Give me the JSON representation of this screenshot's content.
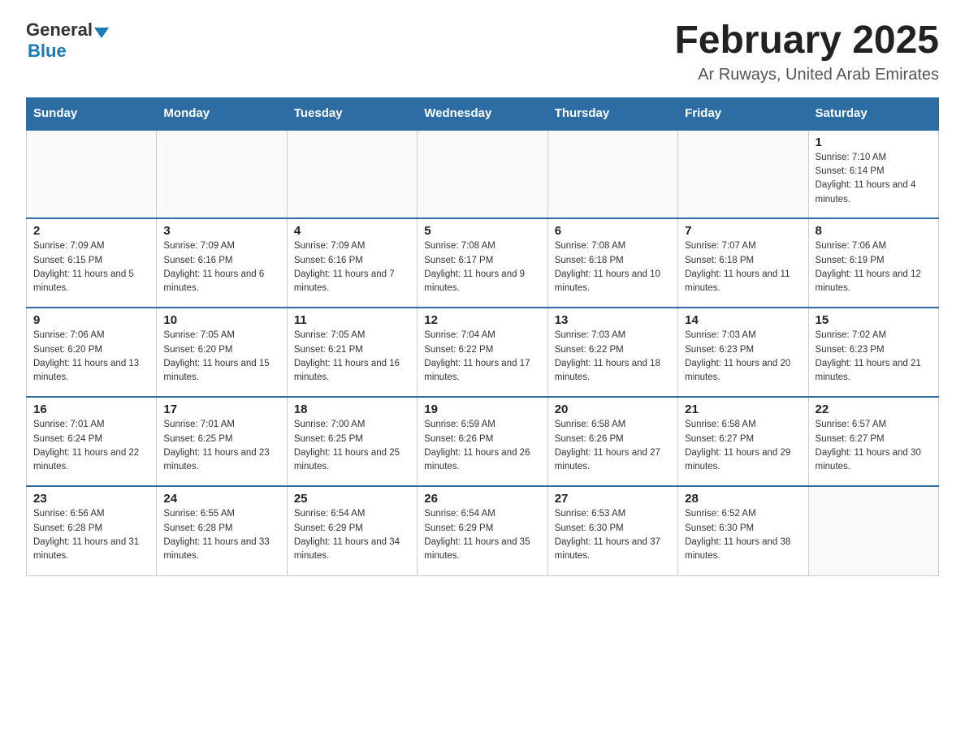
{
  "header": {
    "logo_general": "General",
    "logo_blue": "Blue",
    "month_title": "February 2025",
    "location": "Ar Ruways, United Arab Emirates"
  },
  "days_of_week": [
    "Sunday",
    "Monday",
    "Tuesday",
    "Wednesday",
    "Thursday",
    "Friday",
    "Saturday"
  ],
  "weeks": [
    [
      {
        "day": "",
        "info": ""
      },
      {
        "day": "",
        "info": ""
      },
      {
        "day": "",
        "info": ""
      },
      {
        "day": "",
        "info": ""
      },
      {
        "day": "",
        "info": ""
      },
      {
        "day": "",
        "info": ""
      },
      {
        "day": "1",
        "info": "Sunrise: 7:10 AM\nSunset: 6:14 PM\nDaylight: 11 hours and 4 minutes."
      }
    ],
    [
      {
        "day": "2",
        "info": "Sunrise: 7:09 AM\nSunset: 6:15 PM\nDaylight: 11 hours and 5 minutes."
      },
      {
        "day": "3",
        "info": "Sunrise: 7:09 AM\nSunset: 6:16 PM\nDaylight: 11 hours and 6 minutes."
      },
      {
        "day": "4",
        "info": "Sunrise: 7:09 AM\nSunset: 6:16 PM\nDaylight: 11 hours and 7 minutes."
      },
      {
        "day": "5",
        "info": "Sunrise: 7:08 AM\nSunset: 6:17 PM\nDaylight: 11 hours and 9 minutes."
      },
      {
        "day": "6",
        "info": "Sunrise: 7:08 AM\nSunset: 6:18 PM\nDaylight: 11 hours and 10 minutes."
      },
      {
        "day": "7",
        "info": "Sunrise: 7:07 AM\nSunset: 6:18 PM\nDaylight: 11 hours and 11 minutes."
      },
      {
        "day": "8",
        "info": "Sunrise: 7:06 AM\nSunset: 6:19 PM\nDaylight: 11 hours and 12 minutes."
      }
    ],
    [
      {
        "day": "9",
        "info": "Sunrise: 7:06 AM\nSunset: 6:20 PM\nDaylight: 11 hours and 13 minutes."
      },
      {
        "day": "10",
        "info": "Sunrise: 7:05 AM\nSunset: 6:20 PM\nDaylight: 11 hours and 15 minutes."
      },
      {
        "day": "11",
        "info": "Sunrise: 7:05 AM\nSunset: 6:21 PM\nDaylight: 11 hours and 16 minutes."
      },
      {
        "day": "12",
        "info": "Sunrise: 7:04 AM\nSunset: 6:22 PM\nDaylight: 11 hours and 17 minutes."
      },
      {
        "day": "13",
        "info": "Sunrise: 7:03 AM\nSunset: 6:22 PM\nDaylight: 11 hours and 18 minutes."
      },
      {
        "day": "14",
        "info": "Sunrise: 7:03 AM\nSunset: 6:23 PM\nDaylight: 11 hours and 20 minutes."
      },
      {
        "day": "15",
        "info": "Sunrise: 7:02 AM\nSunset: 6:23 PM\nDaylight: 11 hours and 21 minutes."
      }
    ],
    [
      {
        "day": "16",
        "info": "Sunrise: 7:01 AM\nSunset: 6:24 PM\nDaylight: 11 hours and 22 minutes."
      },
      {
        "day": "17",
        "info": "Sunrise: 7:01 AM\nSunset: 6:25 PM\nDaylight: 11 hours and 23 minutes."
      },
      {
        "day": "18",
        "info": "Sunrise: 7:00 AM\nSunset: 6:25 PM\nDaylight: 11 hours and 25 minutes."
      },
      {
        "day": "19",
        "info": "Sunrise: 6:59 AM\nSunset: 6:26 PM\nDaylight: 11 hours and 26 minutes."
      },
      {
        "day": "20",
        "info": "Sunrise: 6:58 AM\nSunset: 6:26 PM\nDaylight: 11 hours and 27 minutes."
      },
      {
        "day": "21",
        "info": "Sunrise: 6:58 AM\nSunset: 6:27 PM\nDaylight: 11 hours and 29 minutes."
      },
      {
        "day": "22",
        "info": "Sunrise: 6:57 AM\nSunset: 6:27 PM\nDaylight: 11 hours and 30 minutes."
      }
    ],
    [
      {
        "day": "23",
        "info": "Sunrise: 6:56 AM\nSunset: 6:28 PM\nDaylight: 11 hours and 31 minutes."
      },
      {
        "day": "24",
        "info": "Sunrise: 6:55 AM\nSunset: 6:28 PM\nDaylight: 11 hours and 33 minutes."
      },
      {
        "day": "25",
        "info": "Sunrise: 6:54 AM\nSunset: 6:29 PM\nDaylight: 11 hours and 34 minutes."
      },
      {
        "day": "26",
        "info": "Sunrise: 6:54 AM\nSunset: 6:29 PM\nDaylight: 11 hours and 35 minutes."
      },
      {
        "day": "27",
        "info": "Sunrise: 6:53 AM\nSunset: 6:30 PM\nDaylight: 11 hours and 37 minutes."
      },
      {
        "day": "28",
        "info": "Sunrise: 6:52 AM\nSunset: 6:30 PM\nDaylight: 11 hours and 38 minutes."
      },
      {
        "day": "",
        "info": ""
      }
    ]
  ]
}
